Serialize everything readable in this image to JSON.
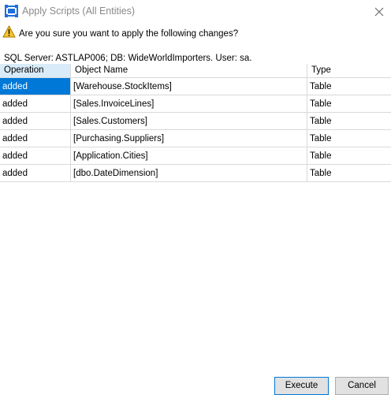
{
  "window": {
    "title": "Apply Scripts (All Entities)",
    "question": "Are you sure you want to apply the following changes?",
    "server_info": "SQL Server:  ASTLAP006; DB: WideWorldImporters. User: sa."
  },
  "table": {
    "columns": [
      "Operation",
      "Object Name",
      "Type"
    ],
    "rows": [
      {
        "operation": "added",
        "object": "[Warehouse.StockItems]",
        "type": "Table"
      },
      {
        "operation": "added",
        "object": "[Sales.InvoiceLines]",
        "type": "Table"
      },
      {
        "operation": "added",
        "object": "[Sales.Customers]",
        "type": "Table"
      },
      {
        "operation": "added",
        "object": "[Purchasing.Suppliers]",
        "type": "Table"
      },
      {
        "operation": "added",
        "object": "[Application.Cities]",
        "type": "Table"
      },
      {
        "operation": "added",
        "object": "[dbo.DateDimension]",
        "type": "Table"
      }
    ]
  },
  "buttons": {
    "execute": "Execute",
    "cancel": "Cancel"
  },
  "icons": {
    "app": "app-window-icon",
    "close": "close-icon",
    "warning": "warning-icon"
  },
  "colors": {
    "selection": "#0078d7",
    "header_selected": "#d9ebf9",
    "grid_line": "#d9d9d9"
  }
}
